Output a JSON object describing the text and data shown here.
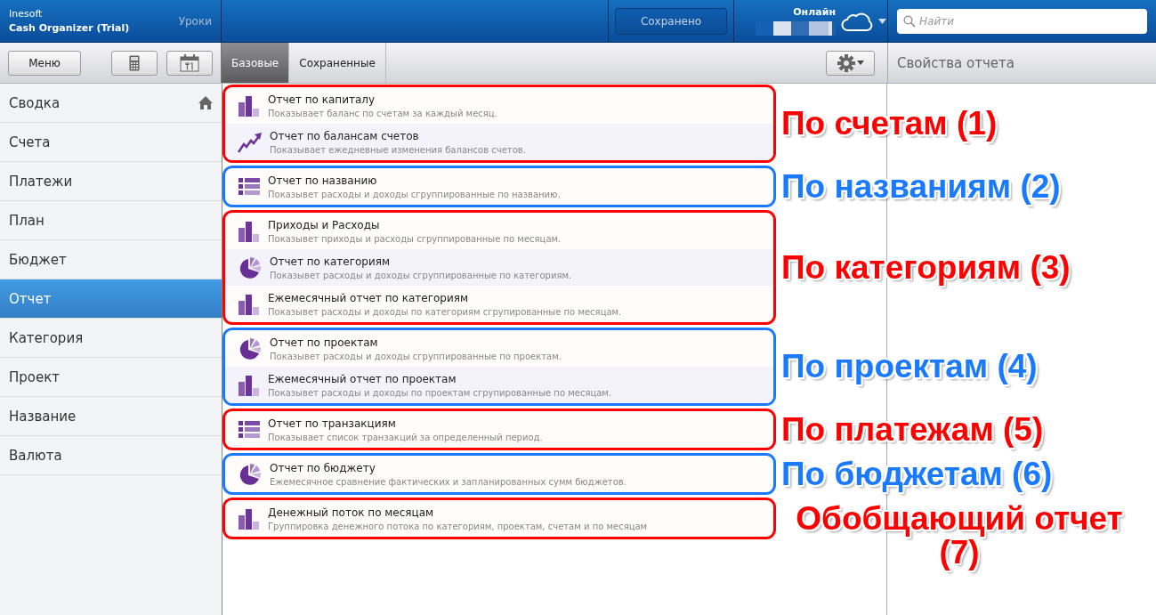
{
  "header": {
    "company": "Inesoft",
    "app_title": "Cash Organizer (Trial)",
    "lessons_link": "Уроки",
    "saved_button": "Сохранено",
    "online_label": "Онлайн",
    "search": {
      "placeholder": "Найти"
    }
  },
  "toolbar": {
    "menu_button": "Меню",
    "tabs": [
      {
        "label": "Базовые",
        "selected": true
      },
      {
        "label": "Сохраненные",
        "selected": false
      }
    ],
    "properties_title": "Свойства отчета"
  },
  "sidebar": {
    "items": [
      {
        "label": "Сводка",
        "selected": false,
        "home": true
      },
      {
        "label": "Счета",
        "selected": false,
        "home": false
      },
      {
        "label": "Платежи",
        "selected": false,
        "home": false
      },
      {
        "label": "План",
        "selected": false,
        "home": false
      },
      {
        "label": "Бюджет",
        "selected": false,
        "home": false
      },
      {
        "label": "Отчет",
        "selected": true,
        "home": false
      },
      {
        "label": "Категория",
        "selected": false,
        "home": false
      },
      {
        "label": "Проект",
        "selected": false,
        "home": false
      },
      {
        "label": "Название",
        "selected": false,
        "home": false
      },
      {
        "label": "Валюта",
        "selected": false,
        "home": false
      }
    ]
  },
  "report_groups": [
    {
      "label": "По счетам (1)",
      "color": "#ff0000",
      "reports": [
        {
          "kind": "bars",
          "title": "Отчет по капиталу",
          "description": "Показывает баланс по счетам за каждый месяц."
        },
        {
          "kind": "trend",
          "title": "Отчет по балансам счетов",
          "description": "Показывает ежедневные изменения балансов счетов."
        }
      ]
    },
    {
      "label": "По названиям (2)",
      "color": "#1a7aff",
      "reports": [
        {
          "kind": "list",
          "title": "Отчет по названию",
          "description": "Показывет расходы и доходы сгруппированные по названию."
        }
      ]
    },
    {
      "label": "По категориям (3)",
      "color": "#ff0000",
      "reports": [
        {
          "kind": "bars",
          "title": "Приходы и Расходы",
          "description": "Показывет приходы и расходы сгруппированные по месяцам."
        },
        {
          "kind": "pie",
          "title": "Отчет по категориям",
          "description": "Показывет расходы и доходы сгруппированные по категориям."
        },
        {
          "kind": "bars",
          "title": "Ежемесячный отчет по категориям",
          "description": "Показывет расходы и доходы по категориям сгрупированные по месяцам."
        }
      ]
    },
    {
      "label": "По проектам (4)",
      "color": "#1a7aff",
      "reports": [
        {
          "kind": "pie",
          "title": "Отчет по проектам",
          "description": "Показывет расходы и доходы сгруппированные по проектам."
        },
        {
          "kind": "bars",
          "title": "Ежемесячный отчет по проектам",
          "description": "Показывет расходы и доходы по проектам сгрупированные по месяцам."
        }
      ]
    },
    {
      "label": "По платежам (5)",
      "color": "#ff0000",
      "reports": [
        {
          "kind": "list",
          "title": "Отчет по транзакциям",
          "description": "Показывает список транзакций за определенный период."
        }
      ]
    },
    {
      "label": "По бюджетам (6)",
      "color": "#1a7aff",
      "reports": [
        {
          "kind": "pie",
          "title": "Отчет по бюджету",
          "description": "Ежемесячное сравнение фактических и запланированных сумм бюджетов."
        }
      ]
    },
    {
      "label": "Обобщающий отчет (7)",
      "color": "#ff0000",
      "reports": [
        {
          "kind": "bars",
          "title": "Денежный поток по месяцам",
          "description": "Группировка денежного потока по категориям, проектам, счетам и по месяцам"
        }
      ]
    }
  ]
}
